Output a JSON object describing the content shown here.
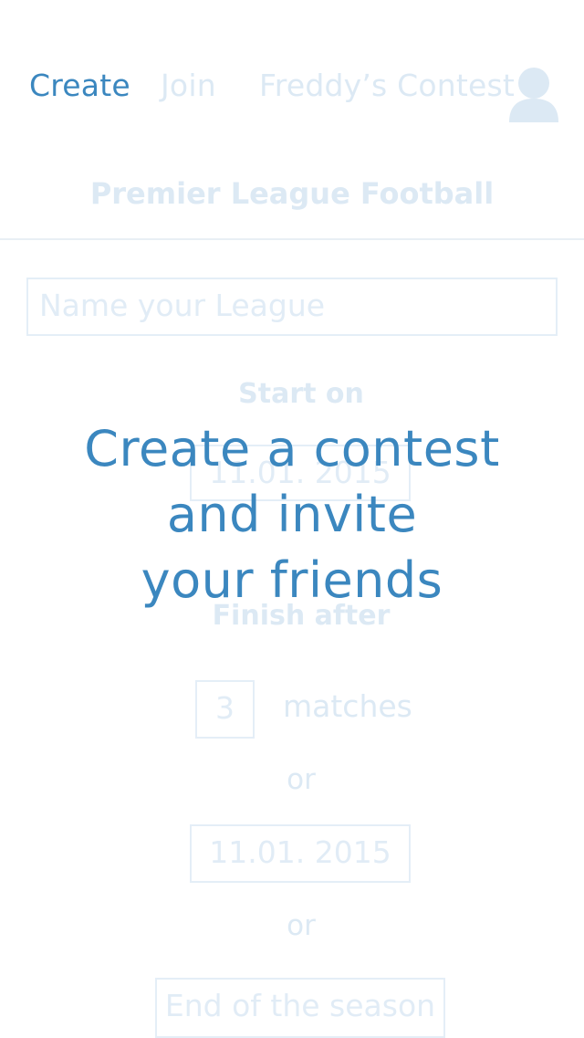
{
  "nav": {
    "create_label": "Create",
    "join_label": "Join",
    "contest_label": "Freddy’s Contest",
    "avatar_icon": "user-avatar-icon"
  },
  "header": {
    "subtitle": "Premier League Football"
  },
  "form": {
    "name_placeholder": "Name your League",
    "start_label": "Start on",
    "start_date": "11.01. 2015",
    "finish_label": "Finish after",
    "matches_value": "3",
    "matches_label": "matches",
    "or_label": "or",
    "end_date": "11.01. 2015",
    "season_label": "End of the season"
  },
  "overlay": {
    "line1": "Create a contest",
    "line2": "and invite",
    "line3": "your friends"
  },
  "colors": {
    "accent": "#3b87bf",
    "faded": "#dce9f4"
  }
}
